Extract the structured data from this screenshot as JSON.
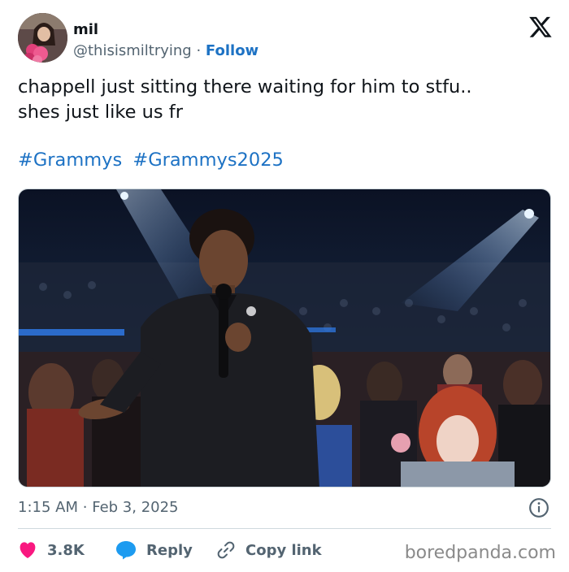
{
  "author": {
    "name": "mil",
    "handle": "@thisismiltrying",
    "separator": "·",
    "follow_label": "Follow"
  },
  "tweet": {
    "lines": [
      "chappell just sitting there waiting for him to stfu..",
      "shes just like us fr"
    ],
    "hashtags": [
      "#Grammys",
      "#Grammys2025"
    ]
  },
  "meta": {
    "time": "1:15 AM",
    "separator": "·",
    "date": "Feb 3, 2025"
  },
  "actions": {
    "like_count": "3.8K",
    "reply_label": "Reply",
    "copy_label": "Copy link"
  },
  "watermark": "boredpanda.com",
  "colors": {
    "link": "#1d72c4",
    "like": "#f91880",
    "reply": "#1d9bf0",
    "muted": "#536471"
  }
}
